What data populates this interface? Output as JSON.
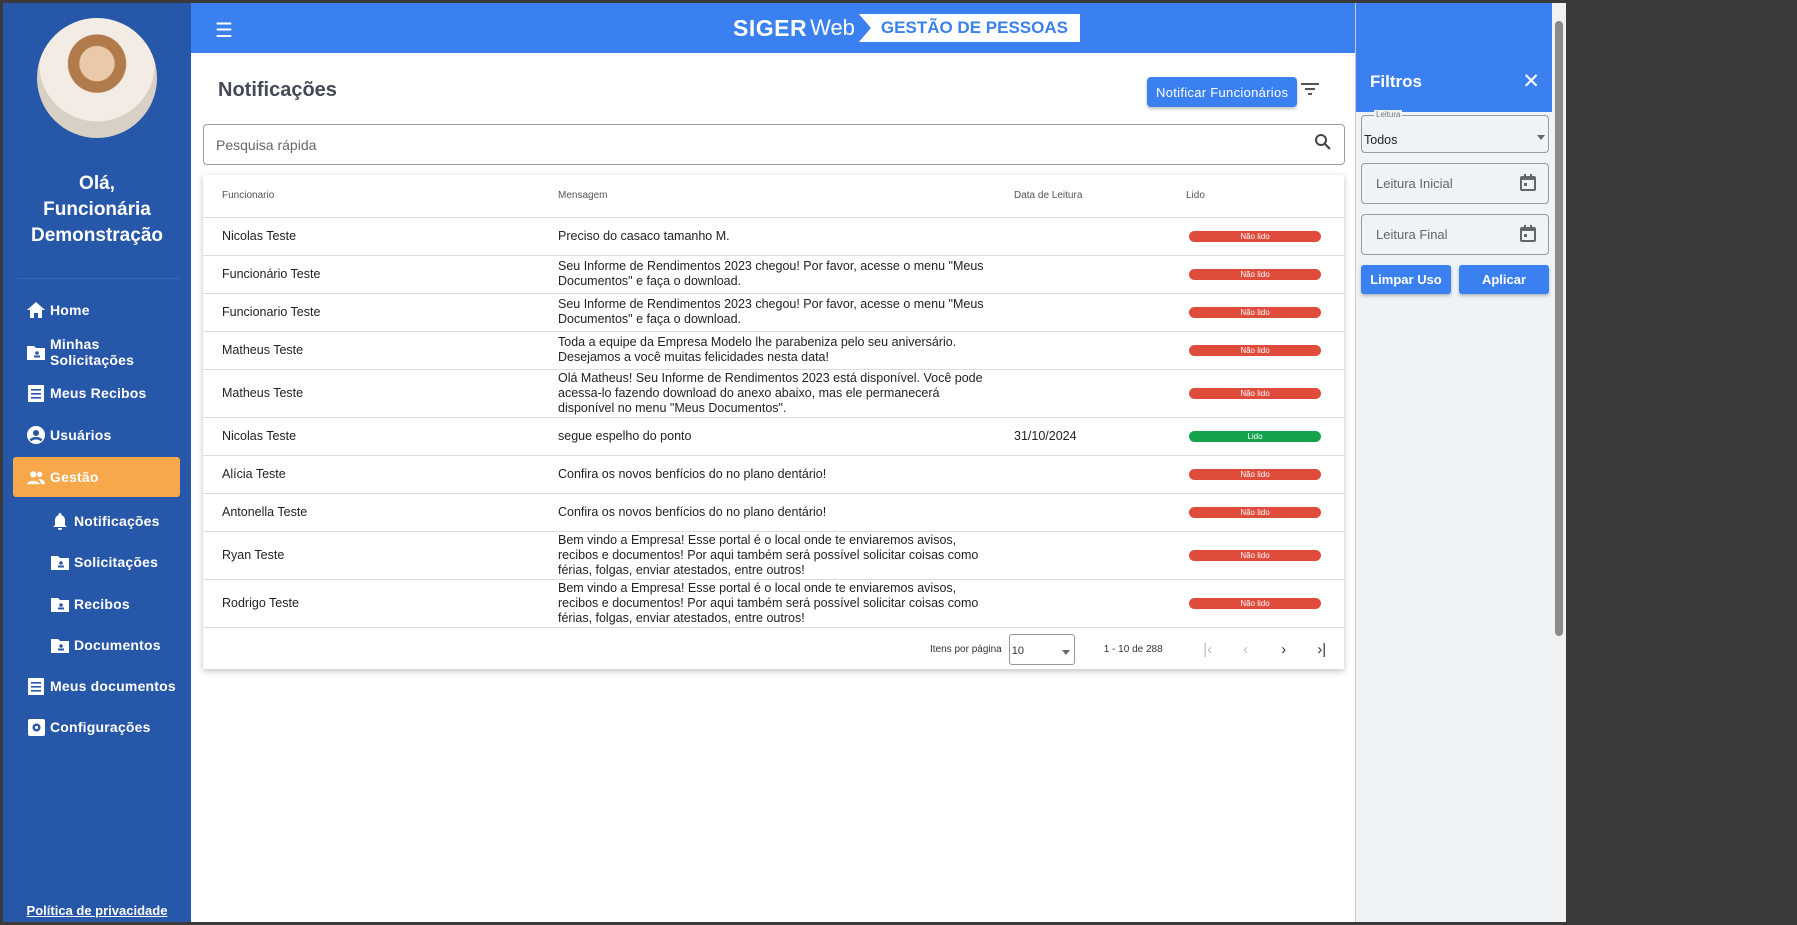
{
  "sidebar": {
    "greeting_line1": "Olá,",
    "greeting_line2": "Funcionária",
    "greeting_line3": "Demonstração",
    "items": [
      {
        "label": "Home"
      },
      {
        "label": "Minhas Solicitações"
      },
      {
        "label": "Meus Recibos"
      },
      {
        "label": "Usuários"
      },
      {
        "label": "Gestão"
      },
      {
        "label": "Notificações"
      },
      {
        "label": "Solicitações"
      },
      {
        "label": "Recibos"
      },
      {
        "label": "Documentos"
      },
      {
        "label": "Meus documentos"
      },
      {
        "label": "Configurações"
      }
    ],
    "privacy": "Política de privacidade"
  },
  "header": {
    "logo_siger": "SIGER",
    "logo_web": "Web",
    "logo_tag": "GESTÃO DE PESSOAS"
  },
  "main": {
    "title": "Notificações",
    "notify_button": "Notificar Funcionários",
    "search_placeholder": "Pesquisa rápida",
    "columns": [
      "Funcionario",
      "Mensagem",
      "Data de Leitura",
      "Lido"
    ],
    "rows": [
      {
        "name": "Nicolas Teste",
        "message": "Preciso do casaco tamanho M.",
        "date": "",
        "status": "Não lido"
      },
      {
        "name": "Funcionário Teste",
        "message": "Seu Informe de Rendimentos 2023 chegou! Por favor, acesse o menu \"Meus Documentos\" e faça o download.",
        "date": "",
        "status": "Não lido"
      },
      {
        "name": "Funcionario Teste",
        "message": "Seu Informe de Rendimentos 2023 chegou! Por favor, acesse o menu \"Meus Documentos\" e faça o download.",
        "date": "",
        "status": "Não lido"
      },
      {
        "name": "Matheus Teste",
        "message": "Toda a equipe da Empresa Modelo lhe parabeniza pelo seu aniversário. Desejamos a você muitas felicidades nesta data!",
        "date": "",
        "status": "Não lido"
      },
      {
        "name": "Matheus Teste",
        "message": "Olá Matheus! Seu Informe de Rendimentos 2023 está disponível. Você pode acessa-lo fazendo download do anexo abaixo, mas ele permanecerá disponível no menu \"Meus Documentos\".",
        "date": "",
        "status": "Não lido"
      },
      {
        "name": "Nicolas Teste",
        "message": "segue espelho do ponto",
        "date": "31/10/2024",
        "status": "Lido"
      },
      {
        "name": "Alícia Teste",
        "message": "Confira os novos benfícios do no plano dentário!",
        "date": "",
        "status": "Não lido"
      },
      {
        "name": "Antonella Teste",
        "message": "Confira os novos benfícios do no plano dentário!",
        "date": "",
        "status": "Não lido"
      },
      {
        "name": "Ryan Teste",
        "message": "Bem vindo a Empresa! Esse portal é o local onde te enviaremos avisos, recibos e documentos! Por aqui também será possível solicitar coisas como férias, folgas, enviar atestados, entre outros!",
        "date": "",
        "status": "Não lido"
      },
      {
        "name": "Rodrigo Teste",
        "message": "Bem vindo a Empresa! Esse portal é o local onde te enviaremos avisos, recibos e documentos! Por aqui também será possível solicitar coisas como férias, folgas, enviar atestados, entre outros!",
        "date": "",
        "status": "Não lido"
      }
    ],
    "pager": {
      "label": "Itens por página",
      "per_page": "10",
      "range": "1 - 10 de 288"
    }
  },
  "filters": {
    "title": "Filtros",
    "leitura_label": "Leitura",
    "leitura_value": "Todos",
    "start_placeholder": "Leitura Inicial",
    "end_placeholder": "Leitura Final",
    "clear": "Limpar Uso",
    "apply": "Aplicar"
  },
  "colors": {
    "primary": "#3a80f0",
    "sidebar": "#2757a8",
    "active": "#f6a84a",
    "unread": "#df4c3c",
    "read": "#14a34a"
  }
}
